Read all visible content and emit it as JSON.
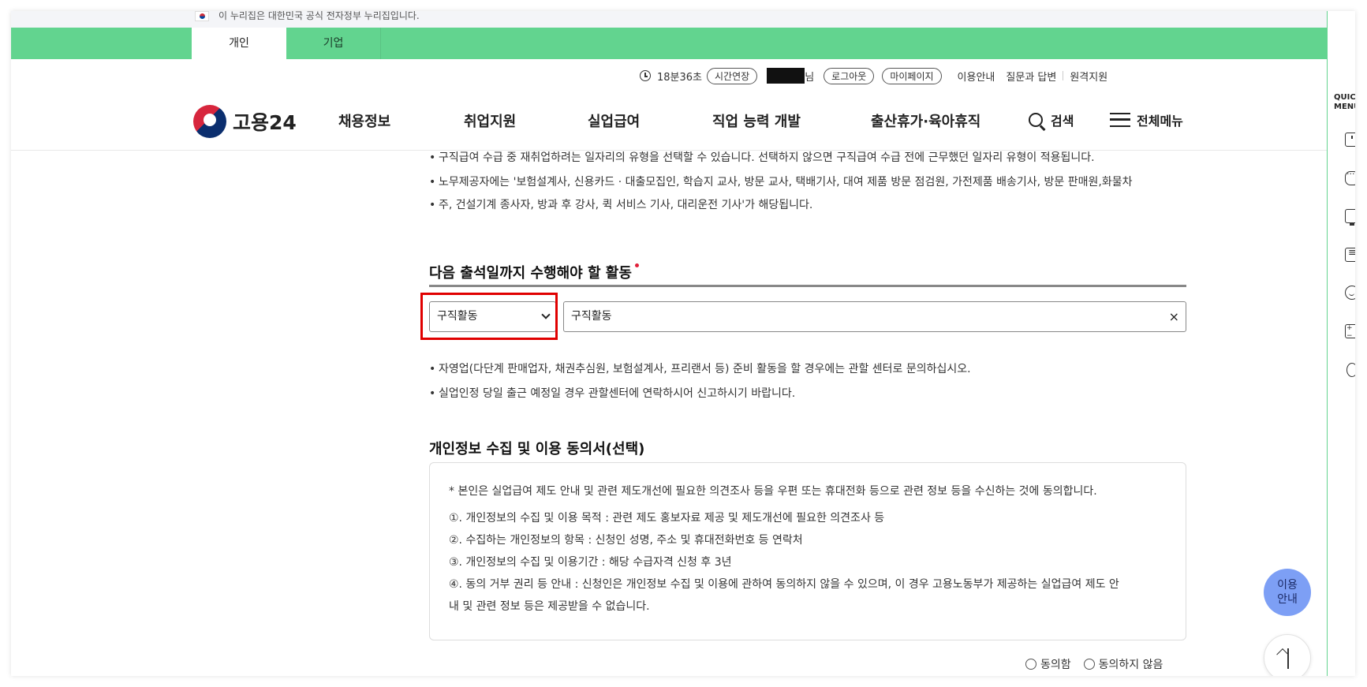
{
  "gov_banner": {
    "text": "이 누리집은 대한민국 공식 전자정부 누리집입니다."
  },
  "tabs": [
    {
      "label": "개인",
      "active": true
    },
    {
      "label": "기업",
      "active": false
    }
  ],
  "utility": {
    "timer": "18분36초",
    "extend_label": "시간연장",
    "user_suffix": "님",
    "logout_label": "로그아웃",
    "mypage_label": "마이페이지",
    "links": [
      "이용안내",
      "질문과 답변",
      "원격지원"
    ]
  },
  "logo": {
    "text": "고용24"
  },
  "gnb": {
    "items": [
      "채용정보",
      "취업지원",
      "실업급여",
      "직업 능력 개발",
      "출산휴가·육아휴직"
    ],
    "search_label": "검색",
    "menu_label": "전체메뉴"
  },
  "notes_top": [
    "구직급여 수급 중 재취업하려는 일자리의 유형을 선택할 수 있습니다. 선택하지 않으면 구직급여 수급 전에 근무했던 일자리 유형이 적용됩니다.",
    "노무제공자에는 '보험설계사, 신용카드 · 대출모집인, 학습지 교사, 방문 교사, 택배기사, 대여 제품 방문 점검원, 가전제품 배송기사, 방문 판매원,화물차",
    "주, 건설기계 종사자, 방과 후 강사, 퀵 서비스 기사, 대리운전 기사'가 해당됩니다."
  ],
  "activity": {
    "title": "다음 출석일까지 수행해야 할 활동",
    "select_value": "구직활동",
    "input_value": "구직활동",
    "clear_label": "×",
    "notes": [
      "자영업(다단계 판매업자, 채권추심원, 보험설계사, 프리랜서 등) 준비 활동을 할 경우에는 관할 센터로 문의하십시오.",
      "실업인정 당일 출근 예정일 경우 관할센터에 연락하시어 신고하시기 바랍니다."
    ]
  },
  "consent": {
    "title": "개인정보 수집 및 이용 동의서(선택)",
    "intro": "* 본인은 실업급여 제도 안내 및 관련 제도개선에 필요한 의견조사 등을 우편 또는 휴대전화 등으로 관련 정보 등을 수신하는 것에 동의합니다.",
    "items": [
      "①. 개인정보의 수집 및 이용 목적 : 관련 제도 홍보자료 제공 및 제도개선에 필요한 의견조사 등",
      "②. 수집하는 개인정보의 항목 : 신청인 성명, 주소 및 휴대전화번호 등 연락처",
      "③. 개인정보의 수집 및 이용기간 : 해당 수급자격 신청 후 3년",
      "④. 동의 거부 권리 등 안내 : 신청인은 개인정보 수집 및 이용에 관하여 동의하지 않을 수 있으며, 이 경우 고용노동부가 제공하는 실업급여 제도 안",
      "내 및 관련 정보 등은 제공받을 수 없습니다."
    ],
    "agree_label": "동의함",
    "disagree_label": "동의하지 않음"
  },
  "quick_menu": {
    "label_line1": "QUICK",
    "label_line2": "MENU"
  },
  "floating": {
    "guide_line1": "이용",
    "guide_line2": "안내"
  },
  "colors": {
    "accent_green": "#62d48f",
    "highlight_red": "#e00000",
    "guide_blue": "#7d9ff5"
  }
}
